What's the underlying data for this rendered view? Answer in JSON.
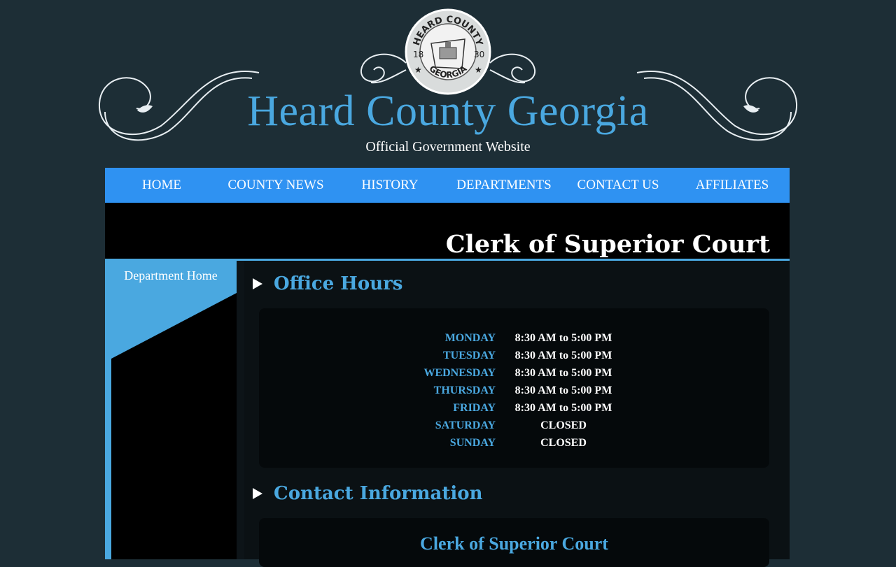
{
  "header": {
    "seal_text_top": "HEARD COUNTY",
    "seal_text_bottom": "GEORGIA",
    "seal_year_left": "18",
    "seal_year_right": "30",
    "title": "Heard County Georgia",
    "subtitle": "Official Government Website"
  },
  "nav": {
    "items": [
      {
        "label": "HOME"
      },
      {
        "label": "COUNTY NEWS"
      },
      {
        "label": "HISTORY"
      },
      {
        "label": "DEPARTMENTS"
      },
      {
        "label": "CONTACT US"
      },
      {
        "label": "AFFILIATES"
      }
    ]
  },
  "page": {
    "title": "Clerk of Superior Court"
  },
  "sidebar": {
    "link_label": "Department Home"
  },
  "office_hours": {
    "heading": "Office Hours",
    "rows": [
      {
        "day": "MONDAY",
        "hours": "8:30 AM to 5:00 PM"
      },
      {
        "day": "TUESDAY",
        "hours": "8:30 AM to 5:00 PM"
      },
      {
        "day": "WEDNESDAY",
        "hours": "8:30 AM to 5:00 PM"
      },
      {
        "day": "THURSDAY",
        "hours": "8:30 AM to 5:00 PM"
      },
      {
        "day": "FRIDAY",
        "hours": "8:30 AM to 5:00 PM"
      },
      {
        "day": "SATURDAY",
        "hours": "CLOSED"
      },
      {
        "day": "SUNDAY",
        "hours": "CLOSED"
      }
    ]
  },
  "contact": {
    "heading": "Contact Information",
    "office_name": "Clerk of Superior Court"
  },
  "colors": {
    "background": "#1d2e36",
    "accent": "#4aa8e0",
    "nav": "#2f92f2"
  }
}
